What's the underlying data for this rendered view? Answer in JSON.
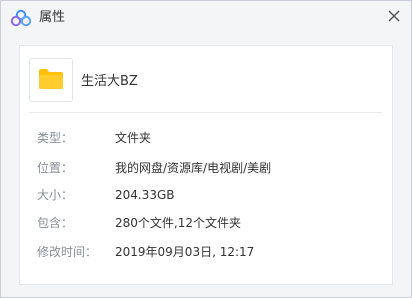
{
  "window": {
    "title": "属性",
    "close_icon": "close-icon",
    "app_icon": "cloud-logo-icon"
  },
  "file": {
    "icon": "folder-icon",
    "name": "生活大BZ"
  },
  "properties": [
    {
      "label": "类型：",
      "value": "文件夹"
    },
    {
      "label": "位置：",
      "value": "我的网盘/资源库/电视剧/美剧"
    },
    {
      "label": "大小：",
      "value": "204.33GB"
    },
    {
      "label": "包含：",
      "value": "280个文件,12个文件夹"
    },
    {
      "label": "修改时间：",
      "value": "2019年09月03日, 12:17"
    }
  ],
  "colors": {
    "folder": "#ffc107",
    "logo_blue": "#3f8ef5",
    "logo_purple": "#8c6bf0"
  }
}
